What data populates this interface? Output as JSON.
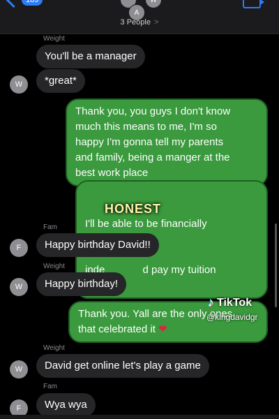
{
  "header": {
    "back_badge": "189",
    "avatars": [
      "A",
      "W"
    ],
    "people_label": "3 People",
    "people_chevron": ">"
  },
  "messages": [
    {
      "sender": "Weight",
      "text": "You'll be a manager",
      "avatar": ""
    },
    {
      "sender": "",
      "text": "*great*",
      "avatar": "W"
    },
    {
      "sender": "",
      "text": "Thank you, you guys I don't know much this means to me, I'm so happy I'm gonna tell my parents and family, being a manger at the best work place",
      "lines": [
        "Thank you, you guys I don't know",
        "much this means to me, I'm so",
        "happy I'm gonna tell my parents",
        "and family, being a manger at the",
        "best work place"
      ]
    },
    {
      "sender": "",
      "text": "I'll be able to be financially independent and pay my tuition",
      "lines": [
        "I'll be able to be financially",
        "inde             d pay my tuition"
      ]
    },
    {
      "sender": "Fam",
      "text": "Happy birthday David!!",
      "avatar": "F"
    },
    {
      "sender": "Weight",
      "text": "Happy birthday!",
      "avatar": "W"
    },
    {
      "sender": "",
      "text": "Thank you. Yall are the only ones that celebrated it",
      "lines": [
        "Thank you. Yall are the only ones",
        "that celebrated it"
      ]
    },
    {
      "sender": "Weight",
      "text": "David get online let's play a game",
      "avatar": "W"
    },
    {
      "sender": "Fam",
      "text": "Wya wya",
      "avatar": "F"
    }
  ],
  "overlays": {
    "honest": "HONEST",
    "tiktok": "TikTok",
    "username": "@kingdavidgr",
    "heart": "❤"
  },
  "colors": {
    "outgoing_bubble": "#3a9a3d",
    "incoming_bubble": "#262628",
    "accent": "#2f7cf6"
  }
}
